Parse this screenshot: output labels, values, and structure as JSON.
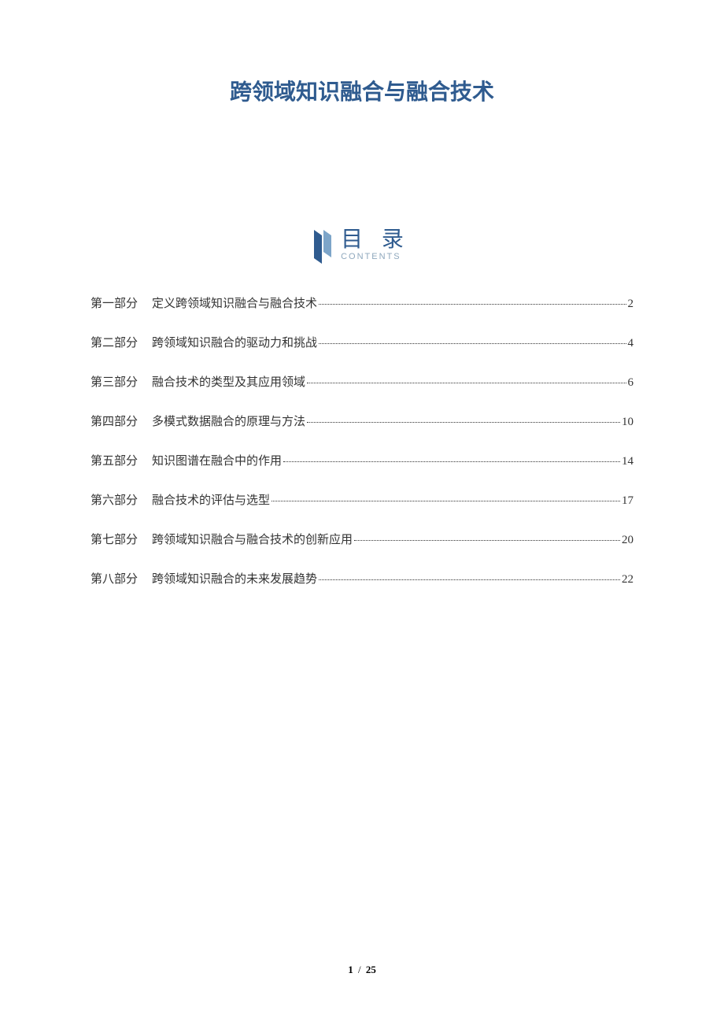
{
  "title": "跨领域知识融合与融合技术",
  "toc": {
    "heading_cn": "目 录",
    "heading_en": "CONTENTS",
    "entries": [
      {
        "part": "第一部分",
        "title": "定义跨领域知识融合与融合技术",
        "page": "2"
      },
      {
        "part": "第二部分",
        "title": "跨领域知识融合的驱动力和挑战",
        "page": "4"
      },
      {
        "part": "第三部分",
        "title": "融合技术的类型及其应用领域",
        "page": "6"
      },
      {
        "part": "第四部分",
        "title": "多模式数据融合的原理与方法",
        "page": "10"
      },
      {
        "part": "第五部分",
        "title": "知识图谱在融合中的作用",
        "page": "14"
      },
      {
        "part": "第六部分",
        "title": "融合技术的评估与选型",
        "page": "17"
      },
      {
        "part": "第七部分",
        "title": "跨领域知识融合与融合技术的创新应用",
        "page": "20"
      },
      {
        "part": "第八部分",
        "title": "跨领域知识融合的未来发展趋势",
        "page": "22"
      }
    ]
  },
  "footer": {
    "current_page": "1",
    "separator": "/",
    "total_pages": "25"
  }
}
